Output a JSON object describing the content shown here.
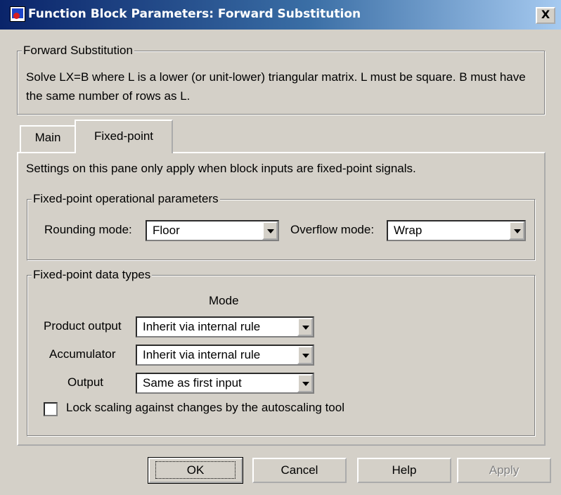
{
  "window": {
    "title": "Function Block Parameters: Forward Substitution",
    "close_label": "X"
  },
  "description": {
    "group_title": "Forward Substitution",
    "text": "Solve LX=B where L is a lower (or unit-lower) triangular matrix.  L must be square.  B must have the same number of rows as L."
  },
  "tabs": [
    {
      "label": "Main",
      "active": false
    },
    {
      "label": "Fixed-point",
      "active": true
    }
  ],
  "panel": {
    "info": "Settings on this pane only apply when block inputs are fixed-point signals.",
    "operational": {
      "title": "Fixed-point operational parameters",
      "rounding_label": "Rounding mode:",
      "rounding_value": "Floor",
      "overflow_label": "Overflow mode:",
      "overflow_value": "Wrap"
    },
    "data_types": {
      "title": "Fixed-point data types",
      "mode_header": "Mode",
      "rows": [
        {
          "label": "Product output",
          "value": "Inherit via internal rule"
        },
        {
          "label": "Accumulator",
          "value": "Inherit via internal rule"
        },
        {
          "label": "Output",
          "value": "Same as first input"
        }
      ],
      "lock_label": "Lock scaling against changes by the autoscaling tool",
      "lock_checked": false
    }
  },
  "buttons": {
    "ok": "OK",
    "cancel": "Cancel",
    "help": "Help",
    "apply": "Apply"
  }
}
